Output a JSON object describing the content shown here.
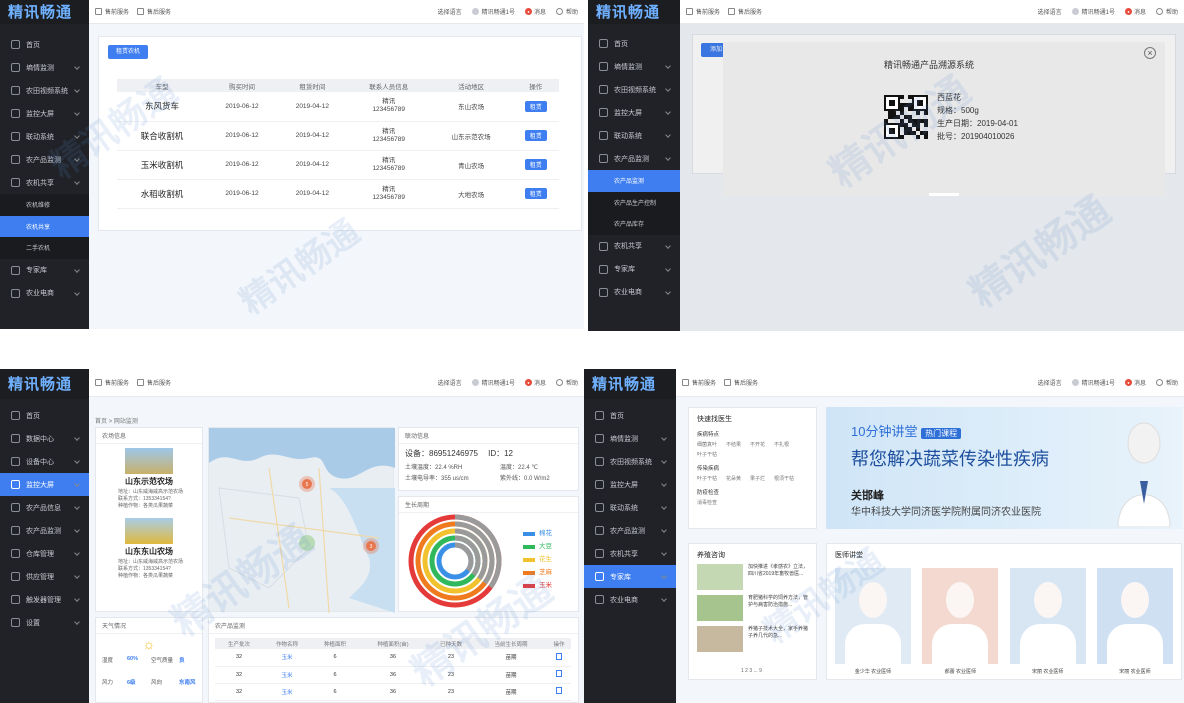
{
  "brand": "精讯畅通",
  "topbar": {
    "market": "售前服务",
    "service": "售后服务",
    "lang": "选择语言",
    "user": "精讯畅通1号",
    "notice": "消息",
    "help": "帮助"
  },
  "watermark": "精讯畅通",
  "p1": {
    "menu": [
      {
        "label": "首页"
      },
      {
        "label": "墒情监测"
      },
      {
        "label": "农田视频系统"
      },
      {
        "label": "监控大屏"
      },
      {
        "label": "联动系统"
      },
      {
        "label": "农产品监测"
      },
      {
        "label": "农机共享"
      },
      {
        "label": "农机维修",
        "sub": true
      },
      {
        "label": "农机共享",
        "sub": true,
        "active": true
      },
      {
        "label": "二手农机",
        "sub": true
      },
      {
        "label": "专家库"
      },
      {
        "label": "农业电商"
      }
    ],
    "add_button": "租赁农机",
    "headers": [
      "车型",
      "购买时间",
      "租赁时间",
      "联系人员信息",
      "活动地区",
      "操作"
    ],
    "rows": [
      {
        "model": "东风货车",
        "buy": "2019-06-12",
        "rent": "2019-04-12",
        "contact_name": "精讯",
        "contact_phone": "123456789",
        "area": "东山农场",
        "action": "租赁"
      },
      {
        "model": "联合收割机",
        "buy": "2019-06-12",
        "rent": "2019-04-12",
        "contact_name": "精讯",
        "contact_phone": "123456789",
        "area": "山东示范农场",
        "action": "租赁"
      },
      {
        "model": "玉米收割机",
        "buy": "2019-06-12",
        "rent": "2019-04-12",
        "contact_name": "精讯",
        "contact_phone": "123456789",
        "area": "青山农场",
        "action": "租赁"
      },
      {
        "model": "水稻收割机",
        "buy": "2019-06-12",
        "rent": "2019-04-12",
        "contact_name": "精讯",
        "contact_phone": "123456789",
        "area": "大地农场",
        "action": "租赁"
      }
    ]
  },
  "p2": {
    "menu": [
      {
        "label": "首页"
      },
      {
        "label": "墒情监测"
      },
      {
        "label": "农田视频系统"
      },
      {
        "label": "监控大屏"
      },
      {
        "label": "联动系统"
      },
      {
        "label": "农产品监测"
      },
      {
        "label": "农产品监测",
        "sub": true,
        "active": true
      },
      {
        "label": "农产品生产控制",
        "sub": true
      },
      {
        "label": "农产品库存",
        "sub": true
      },
      {
        "label": "农机共享"
      },
      {
        "label": "专家库"
      },
      {
        "label": "农业电商"
      }
    ],
    "add_button": "添加",
    "modal_title": "精讯畅通产品溯源系统",
    "product": "西蓝花",
    "spec": "规格：500g",
    "date": "生产日期：2019-04-01",
    "batch": "批号：201904010026"
  },
  "p3": {
    "menu": [
      {
        "label": "首页"
      },
      {
        "label": "数据中心"
      },
      {
        "label": "设备中心"
      },
      {
        "label": "监控大屏",
        "active": true
      },
      {
        "label": "农产品信息"
      },
      {
        "label": "农产品监测"
      },
      {
        "label": "仓库管理"
      },
      {
        "label": "供应管理"
      },
      {
        "label": "触发器管理"
      },
      {
        "label": "设置"
      }
    ],
    "breadcrumb": "首页 > 网站监测",
    "farm_box": "农场信息",
    "farms": [
      {
        "name": "山东示范农场",
        "addr": "地址：山东威海威高示范农场",
        "phone": "联系方式：135334154?",
        "crop": "种植作物：各类瓜果蔬菜"
      },
      {
        "name": "山东东山农场",
        "addr": "地址：山东威海威高示范农场",
        "phone": "联系方式：135334154?",
        "crop": "种植作物：各类瓜果蔬菜"
      }
    ],
    "map_markers": [
      "5",
      "3"
    ],
    "device_box": "联动信息",
    "device": {
      "id_label": "设备：",
      "id": "86951246975",
      "no_label": "ID：",
      "no": "12",
      "soil_temp": "土壤温度：22.4 %RH",
      "temp": "温度：22.4 ℃",
      "cond": "土壤电导率：355 us/cm",
      "uv": "紫外线：0.0 W/m2"
    },
    "ring_box": "生长周期",
    "legend": [
      "棉花",
      "大豆",
      "花生",
      "芝麻",
      "玉米"
    ],
    "legend_colors": [
      "#3a8fe6",
      "#2fb95c",
      "#f2c12e",
      "#f07b1e",
      "#e53a3a"
    ],
    "weather_box": "天气情况",
    "weather": {
      "humid_label": "湿度",
      "humid": "60%",
      "air_label": "空气质量",
      "air": "良",
      "wind_label": "风力",
      "wind": "6级",
      "dir_label": "风向",
      "dir": "东南风"
    },
    "monitor_box": "农产品监测",
    "monitor_headers": [
      "生产批次",
      "作物名称",
      "种植面积",
      "种植面积(亩)",
      "已种天数",
      "当前生长周期",
      "操作"
    ],
    "monitor_rows": [
      [
        "32",
        "玉米",
        "6",
        "36",
        "23",
        "苗期"
      ],
      [
        "32",
        "玉米",
        "6",
        "36",
        "23",
        "苗期"
      ],
      [
        "32",
        "玉米",
        "6",
        "36",
        "23",
        "苗期"
      ]
    ]
  },
  "p4": {
    "menu": [
      {
        "label": "首页"
      },
      {
        "label": "墒情监测"
      },
      {
        "label": "农田视频系统"
      },
      {
        "label": "监控大屏"
      },
      {
        "label": "联动系统"
      },
      {
        "label": "农产品监测"
      },
      {
        "label": "农机共享"
      },
      {
        "label": "专家库",
        "active": true
      },
      {
        "label": "农业电商"
      }
    ],
    "find_title": "快速找医生",
    "sections": [
      {
        "title": "疾病特点",
        "items": [
          "细菌真叶",
          "不结果",
          "不开花",
          "不扎根",
          "叶子干枯"
        ]
      },
      {
        "title": "传染疾病",
        "items": [
          "叶子干枯",
          "花朵黄",
          "果子烂",
          "根须干枯"
        ]
      },
      {
        "title": "防疫检查",
        "items": [
          "消毒检查"
        ]
      }
    ],
    "course_title": "10分钟讲堂",
    "course_tag": "热门课程",
    "course_slogan": "帮您解决蔬菜传染性疾病",
    "lecturer": "关邯峰",
    "lecturer_org": "华中科技大学同济医学院附属同济农业医院",
    "consult_title": "养殖咨询",
    "consults": [
      "加快推进《孝感农》立法，四川省2019年畜牧兽医...",
      "育肥猪科学的饲养方法，管护与病害防治措施...",
      "养猪子技术大全，家手养猪子养几代的急..."
    ],
    "pager": "1 2 3 ... 9",
    "doctor_title": "医师讲堂",
    "doctors": [
      "金少华 农业医师",
      "郝蕾 农业医师",
      "宋丽 农业医师",
      "宋丽 农业医师"
    ]
  }
}
